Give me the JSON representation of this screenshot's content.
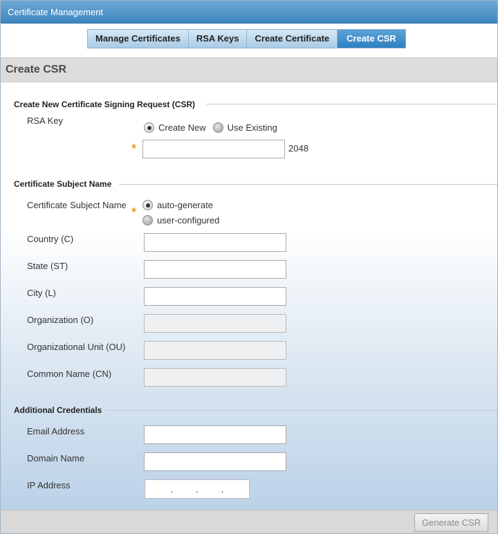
{
  "window": {
    "title": "Certificate Management"
  },
  "tabs": [
    {
      "label": "Manage Certificates"
    },
    {
      "label": "RSA Keys"
    },
    {
      "label": "Create Certificate"
    },
    {
      "label": "Create CSR",
      "active": true
    }
  ],
  "section": {
    "title": "Create CSR"
  },
  "csr_group": {
    "title": "Create New Certificate Signing Request (CSR)",
    "rsa_key_label": "RSA Key",
    "options": [
      "Create New",
      "Use Existing"
    ],
    "selected": "Create New",
    "key_name_value": "",
    "key_size_suffix": "2048"
  },
  "subject_group": {
    "title": "Certificate Subject Name",
    "subject_label": "Certificate Subject Name",
    "options": [
      "auto-generate",
      "user-configured"
    ],
    "selected": "auto-generate",
    "fields": {
      "country": {
        "label": "Country (C)",
        "value": ""
      },
      "state": {
        "label": "State (ST)",
        "value": ""
      },
      "city": {
        "label": "City (L)",
        "value": ""
      },
      "organization": {
        "label": "Organization (O)",
        "value": ""
      },
      "org_unit": {
        "label": "Organizational Unit (OU)",
        "value": ""
      },
      "common_name": {
        "label": "Common Name (CN)",
        "value": ""
      }
    }
  },
  "additional_group": {
    "title": "Additional Credentials",
    "fields": {
      "email": {
        "label": "Email Address",
        "value": ""
      },
      "domain": {
        "label": "Domain Name",
        "value": ""
      },
      "ip": {
        "label": "IP Address",
        "value": ""
      }
    }
  },
  "footer": {
    "generate_label": "Generate CSR"
  },
  "colors": {
    "accent": "#2f7fbf",
    "required_star": "#f0a030"
  }
}
